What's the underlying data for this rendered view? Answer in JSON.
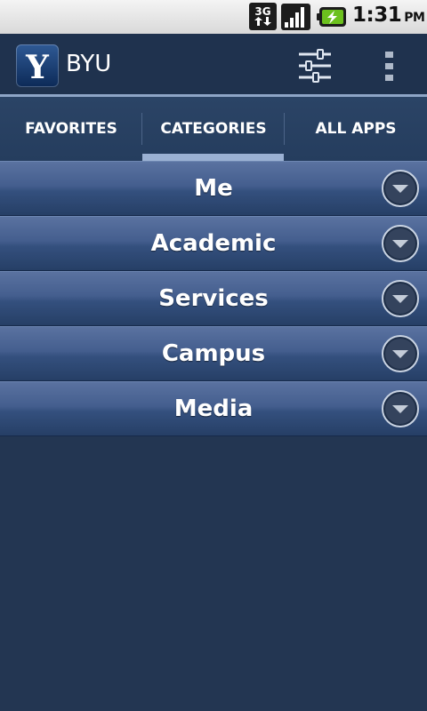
{
  "status_bar": {
    "network": "3G",
    "time": "1:31",
    "ampm": "PM"
  },
  "header": {
    "logo_letter": "Y",
    "title": "BYU"
  },
  "tabs": [
    {
      "label": "FAVORITES"
    },
    {
      "label": "CATEGORIES"
    },
    {
      "label": "ALL APPS"
    }
  ],
  "active_tab": "CATEGORIES",
  "categories": [
    {
      "label": "Me"
    },
    {
      "label": "Academic"
    },
    {
      "label": "Services"
    },
    {
      "label": "Campus"
    },
    {
      "label": "Media"
    }
  ],
  "icons": {
    "expand": "chevron-down-icon",
    "filter": "sliders-icon",
    "overflow": "more-vertical-icon"
  },
  "colors": {
    "background": "#233652",
    "header": "#1f324e",
    "tab_indicator": "#9bb1d3",
    "row_top": "#5a72a0",
    "row_bottom": "#263f66"
  }
}
